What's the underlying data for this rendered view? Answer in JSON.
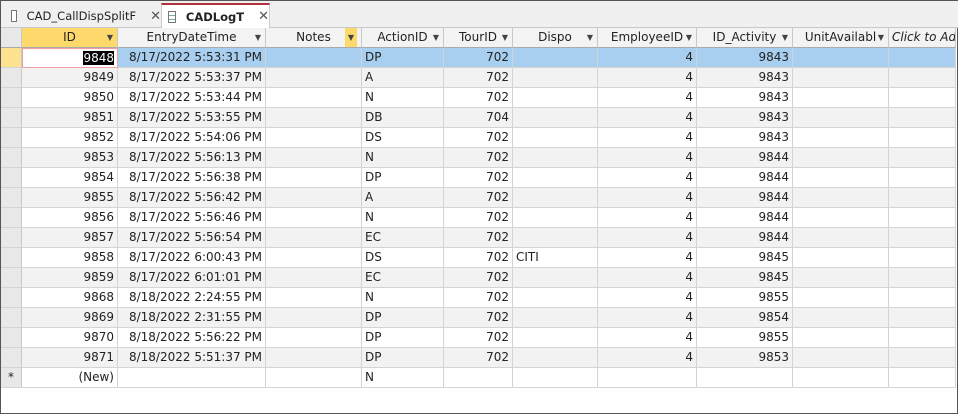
{
  "tabs": [
    {
      "label": "CAD_CallDispSplitF",
      "icon": "form-icon"
    },
    {
      "label": "CADLogT",
      "icon": "table-icon",
      "active": true
    }
  ],
  "columns": [
    "ID",
    "EntryDateTime",
    "Notes",
    "ActionID",
    "TourID",
    "Dispo",
    "EmployeeID",
    "ID_Activity",
    "UnitAvailabl",
    "Click to Add"
  ],
  "rows": [
    [
      "9848",
      "8/17/2022 5:53:31 PM",
      "",
      "DP",
      "702",
      "",
      "4",
      "9843",
      ""
    ],
    [
      "9849",
      "8/17/2022 5:53:37 PM",
      "",
      "A",
      "702",
      "",
      "4",
      "9843",
      ""
    ],
    [
      "9850",
      "8/17/2022 5:53:44 PM",
      "",
      "N",
      "702",
      "",
      "4",
      "9843",
      ""
    ],
    [
      "9851",
      "8/17/2022 5:53:55 PM",
      "",
      "DB",
      "704",
      "",
      "4",
      "9843",
      ""
    ],
    [
      "9852",
      "8/17/2022 5:54:06 PM",
      "",
      "DS",
      "702",
      "",
      "4",
      "9843",
      ""
    ],
    [
      "9853",
      "8/17/2022 5:56:13 PM",
      "",
      "N",
      "702",
      "",
      "4",
      "9844",
      ""
    ],
    [
      "9854",
      "8/17/2022 5:56:38 PM",
      "",
      "DP",
      "702",
      "",
      "4",
      "9844",
      ""
    ],
    [
      "9855",
      "8/17/2022 5:56:42 PM",
      "",
      "A",
      "702",
      "",
      "4",
      "9844",
      ""
    ],
    [
      "9856",
      "8/17/2022 5:56:46 PM",
      "",
      "N",
      "702",
      "",
      "4",
      "9844",
      ""
    ],
    [
      "9857",
      "8/17/2022 5:56:54 PM",
      "",
      "EC",
      "702",
      "",
      "4",
      "9844",
      ""
    ],
    [
      "9858",
      "8/17/2022 6:00:43 PM",
      "",
      "DS",
      "702",
      "CITI",
      "4",
      "9845",
      ""
    ],
    [
      "9859",
      "8/17/2022 6:01:01 PM",
      "",
      "EC",
      "702",
      "",
      "4",
      "9845",
      ""
    ],
    [
      "9868",
      "8/18/2022 2:24:55 PM",
      "",
      "N",
      "702",
      "",
      "4",
      "9855",
      ""
    ],
    [
      "9869",
      "8/18/2022 2:31:55 PM",
      "",
      "DP",
      "702",
      "",
      "4",
      "9854",
      ""
    ],
    [
      "9870",
      "8/18/2022 5:56:22 PM",
      "",
      "DP",
      "702",
      "",
      "4",
      "9855",
      ""
    ],
    [
      "9871",
      "8/18/2022 5:51:37 PM",
      "",
      "DP",
      "702",
      "",
      "4",
      "9853",
      ""
    ]
  ],
  "new_row": {
    "marker": "*",
    "id": "(New)",
    "action": "N"
  }
}
